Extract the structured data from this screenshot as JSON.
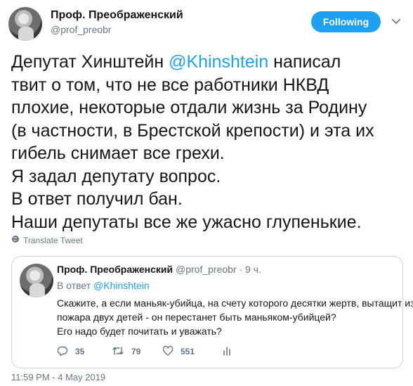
{
  "author": {
    "name": "Проф. Преображенский",
    "handle": "@prof_preobr",
    "follow_label": "Following"
  },
  "tweet": {
    "lines": [
      {
        "before": "Депутат Хинштейн ",
        "mention": "@Khinshtein",
        "after": " написал"
      },
      {
        "text": "твит о том, что не все работники НКВД"
      },
      {
        "text": "плохие, некоторые отдали жизнь за Родину"
      },
      {
        "text": "(в частности, в Брестской крепости) и эта их"
      },
      {
        "text": "гибель снимает все грехи."
      },
      {
        "text": "Я задал депутату вопрос."
      },
      {
        "text": "В ответ получил бан."
      },
      {
        "text": "Наши депутаты все же ужасно глупенькие."
      }
    ],
    "translate_label": "Translate Tweet",
    "timestamp": "11:59 PM - 4 May 2019"
  },
  "quoted": {
    "name": "Проф. Преображенский",
    "meta": " @prof_preobr · 9 ч.",
    "reply_prefix": "В ответ ",
    "reply_mention": "@Khinshtein",
    "body_lines": [
      "Скажите, а если маньяк-убийца, на счету которого десятки жертв, вытащит из",
      "пожара двух детей - он перестанет быть маньяком-убийцей?",
      "Его надо будет почитать и уважать?"
    ],
    "counts": {
      "replies": "35",
      "retweets": "79",
      "likes": "551"
    }
  },
  "icons": {
    "chevron": "chevron-down-icon",
    "globe": "globe-icon",
    "reply": "reply-icon",
    "retweet": "retweet-icon",
    "like": "heart-icon",
    "analytics": "analytics-icon"
  },
  "colors": {
    "accent": "#1da1f2",
    "muted": "#657786",
    "text": "#14171a",
    "border": "#ccd6dd"
  }
}
